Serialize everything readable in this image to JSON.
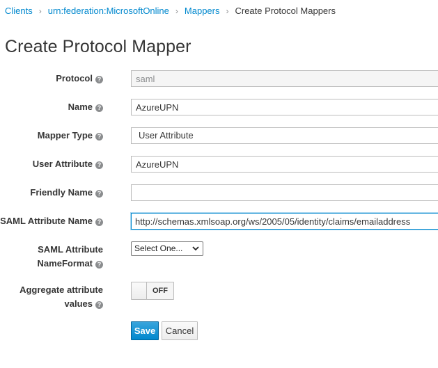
{
  "breadcrumb": {
    "items": [
      "Clients",
      "urn:federation:MicrosoftOnline",
      "Mappers"
    ],
    "current": "Create Protocol Mappers",
    "separator": "›"
  },
  "page": {
    "title": "Create Protocol Mapper"
  },
  "help_icon": "?",
  "form": {
    "protocol": {
      "label": "Protocol",
      "value": "saml"
    },
    "name": {
      "label": "Name",
      "value": "AzureUPN"
    },
    "mapper_type": {
      "label": "Mapper Type",
      "value": "User Attribute"
    },
    "user_attribute": {
      "label": "User Attribute",
      "value": "AzureUPN"
    },
    "friendly_name": {
      "label": "Friendly Name",
      "value": ""
    },
    "saml_attribute_name": {
      "label": "SAML Attribute Name",
      "value": "http://schemas.xmlsoap.org/ws/2005/05/identity/claims/emailaddress"
    },
    "saml_attribute_nameformat": {
      "label_line1": "SAML Attribute",
      "label_line2": "NameFormat",
      "value": "Select One..."
    },
    "aggregate": {
      "label_line1": "Aggregate attribute",
      "label_line2": "values",
      "state": "OFF"
    }
  },
  "actions": {
    "save": "Save",
    "cancel": "Cancel"
  },
  "colors": {
    "accent": "#0088ce",
    "text": "#363636",
    "help_icon": "#8b8d8f"
  }
}
